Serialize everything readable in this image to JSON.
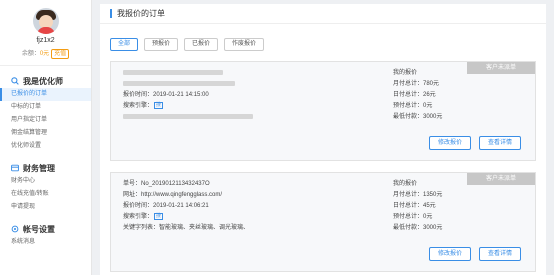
{
  "profile": {
    "username": "fjz1x2",
    "balance_label": "余额：",
    "balance_value": "0元",
    "recharge_label": "充值"
  },
  "sidebar": {
    "groups": [
      {
        "title": "我是优化师",
        "icon": "search-icon",
        "items": [
          "已报价的订单",
          "中标的订单",
          "用户指定订单",
          "佣金结算管理",
          "优化师设置"
        ]
      },
      {
        "title": "财务管理",
        "icon": "wallet-icon",
        "items": [
          "财务中心",
          "在线充值/转账",
          "申请提现"
        ]
      },
      {
        "title": "帐号设置",
        "icon": "gear-icon",
        "items": [
          "系统消息"
        ]
      }
    ]
  },
  "main": {
    "title": "我报价的订单",
    "tabs": [
      "全部",
      "预报价",
      "已报价",
      "作废报价"
    ]
  },
  "orders": [
    {
      "tag": "客户未派单",
      "order_no": "",
      "website": "",
      "quote_time": "报价时间：2019-01-21 14:15:00",
      "engine_label": "搜索引擎：",
      "keywords": "",
      "my_quote": "我的报价",
      "monthly_total": "月付总计：780元",
      "daily_total": "日付总计：26元",
      "first_pay": "预付总计：0元",
      "min_charge": "最低付款：3000元",
      "edit_label": "修改报价",
      "detail_label": "查看详情"
    },
    {
      "tag": "客户未派单",
      "order_no": "单号：No_2019012113432437O",
      "website": "网址：http://www.qingfengglass.com/",
      "quote_time": "报价时间：2019-01-21 14:06:21",
      "engine_label": "搜索引擎：",
      "keywords": "关键字列表：智能玻璃、夹丝玻璃、调光玻璃、",
      "my_quote": "我的报价",
      "monthly_total": "月付总计：1350元",
      "daily_total": "日付总计：45元",
      "first_pay": "预付总计：0元",
      "min_charge": "最低付款：3000元",
      "edit_label": "修改报价",
      "detail_label": "查看详情"
    }
  ],
  "colors": {
    "accent": "#3a8ee6",
    "warning": "#f39c12",
    "tag_bg": "#c7c7c7"
  }
}
